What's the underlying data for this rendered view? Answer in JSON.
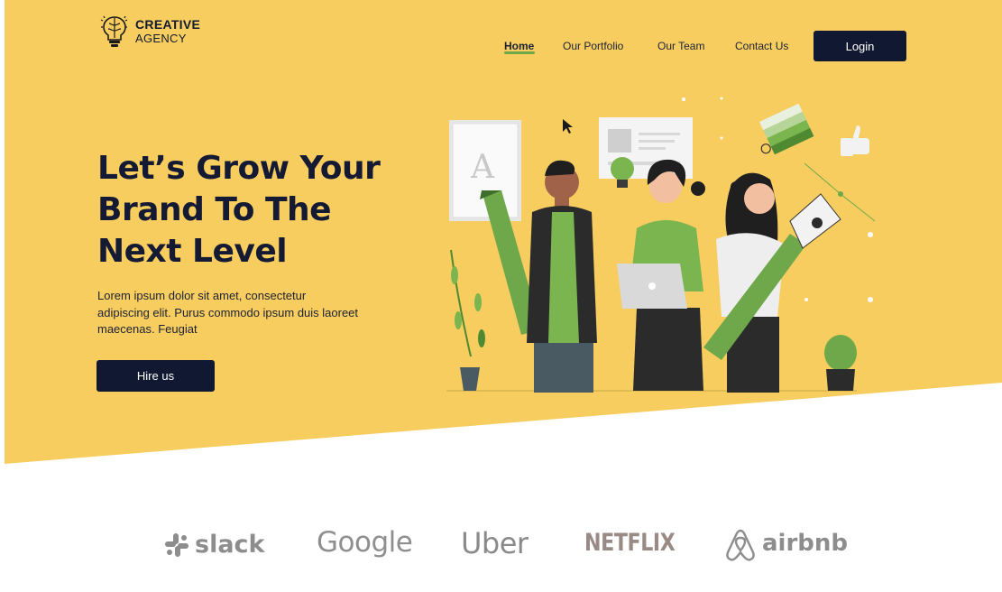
{
  "brand": {
    "line1": "CREATIVE",
    "line2": "AGENCY",
    "icon": "brain-lightbulb-icon"
  },
  "nav": {
    "items": [
      {
        "label": "Home",
        "active": true
      },
      {
        "label": "Our Portfolio",
        "active": false
      },
      {
        "label": "Our Team",
        "active": false
      },
      {
        "label": "Contact Us",
        "active": false
      }
    ],
    "login_label": "Login"
  },
  "hero": {
    "headline": [
      "Let’s Grow Your",
      "Brand To The",
      "Next Level"
    ],
    "blurb": "Lorem ipsum dolor sit amet, consectetur adipiscing elit. Purus commodo ipsum duis laoreet maecenas. Feugiat",
    "cta_label": "Hire us",
    "illustration": "team-with-creative-tools-illustration"
  },
  "partners": [
    {
      "name": "slack",
      "icon": "slack-logo-icon"
    },
    {
      "name": "Google"
    },
    {
      "name": "Uber"
    },
    {
      "name": "NETFLIX"
    },
    {
      "name": "airbnb",
      "icon": "airbnb-logo-icon"
    }
  ],
  "colors": {
    "hero_background": "#f8cd5f",
    "primary_dark": "#111831",
    "accent_green": "#6fa84b",
    "logo_gray": "#8d8d8d"
  }
}
